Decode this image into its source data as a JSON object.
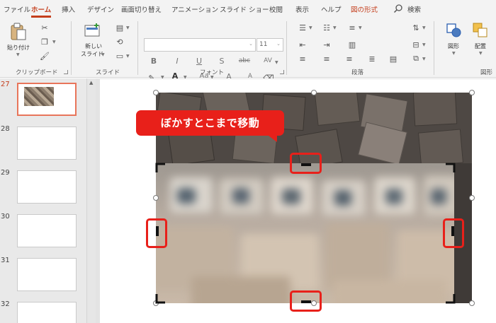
{
  "tabs": [
    {
      "label": "ファイル",
      "active": false
    },
    {
      "label": "ホーム",
      "active": true
    },
    {
      "label": "挿入",
      "active": false
    },
    {
      "label": "デザイン",
      "active": false
    },
    {
      "label": "画面切り替え",
      "active": false
    },
    {
      "label": "アニメーション",
      "active": false
    },
    {
      "label": "スライド ショー",
      "active": false
    },
    {
      "label": "校閲",
      "active": false
    },
    {
      "label": "表示",
      "active": false
    },
    {
      "label": "ヘルプ",
      "active": false
    },
    {
      "label": "図の形式",
      "active": false,
      "contextual": true
    }
  ],
  "search": {
    "label": "検索",
    "icon": "search-icon"
  },
  "ribbon": {
    "clipboard": {
      "paste_label": "貼り付け",
      "group_label": "クリップボード"
    },
    "slides": {
      "new_slide_label_1": "新しい",
      "new_slide_label_2": "スライド",
      "group_label": "スライド"
    },
    "font": {
      "font_name": "",
      "font_size": "11",
      "group_label": "フォント",
      "bold": "B",
      "italic": "I",
      "underline": "U",
      "shadow": "S",
      "strike": "abc",
      "spacing": "AV",
      "case": "Aa",
      "grow": "A",
      "shrink": "A"
    },
    "paragraph": {
      "group_label": "段落"
    },
    "drawing": {
      "shapes_label": "図形",
      "arrange_label": "配置",
      "group_label": "図形"
    }
  },
  "slides_pane": {
    "numbers": [
      "27",
      "28",
      "29",
      "30",
      "31",
      "32"
    ],
    "selected": "27"
  },
  "canvas": {
    "callout_text": "ぼかすとこまで移動"
  },
  "colors": {
    "accent": "#c43e1c",
    "highlight_red": "#e8201a",
    "ribbon_bg": "#f3f3f3"
  }
}
